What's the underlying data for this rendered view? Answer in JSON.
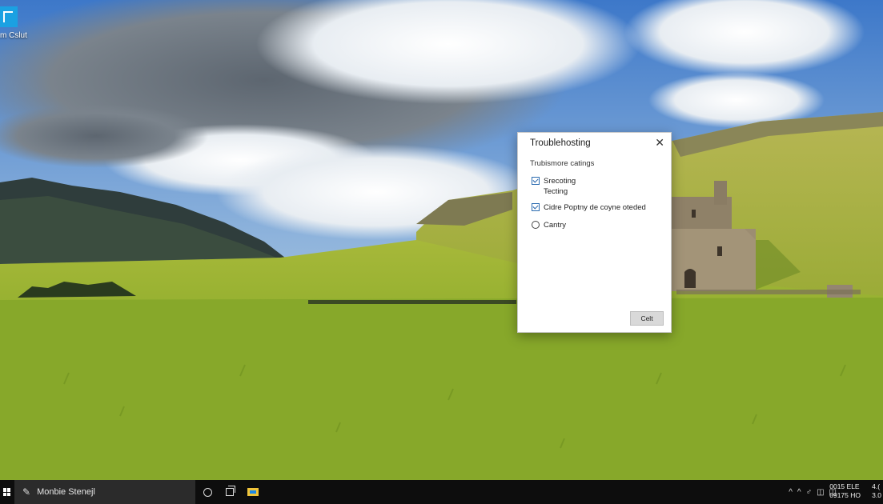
{
  "desktop": {
    "icon_label": "m Cslut"
  },
  "dialog": {
    "title": "Troublehosting",
    "close_glyph": "✕",
    "section_label": "Trubismore catings",
    "options": [
      {
        "label": "Srecoting Tecting",
        "checked": true,
        "kind": "checkbox"
      },
      {
        "label": "Cidre Poptny de coyne oteded",
        "checked": true,
        "kind": "checkbox"
      },
      {
        "label": "Cantry",
        "checked": false,
        "kind": "radio"
      }
    ],
    "button_label": "Celt"
  },
  "taskbar": {
    "search_text": "Monbie Stenejl",
    "tray_icons": [
      "^",
      "^",
      "♂",
      "◫",
      "◫"
    ],
    "clock_line1": "0015 ELE",
    "clock_line2": "09175 HO",
    "notif_line1": "4.(",
    "notif_line2": "3.0"
  },
  "colors": {
    "taskbar": "#0d0d0d",
    "search_box": "#2b2b2b",
    "checkbox_accent": "#1f5ea8"
  }
}
